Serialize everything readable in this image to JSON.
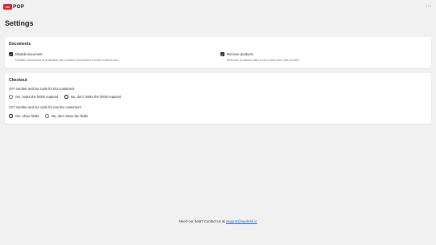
{
  "app": {
    "logo_badge": "ws",
    "logo_text": "POP",
    "more_menu": "···"
  },
  "page": {
    "title": "Settings"
  },
  "documents": {
    "title": "Documents",
    "disable_document": {
      "label": "Disable document",
      "description": "Disable document and disable the number increment if order total is zero.",
      "checked": true
    },
    "remove_products": {
      "label": "Remove products",
      "description": "Remove products with a zero total from the invoice.",
      "checked": true
    }
  },
  "checkout": {
    "title": "Checkout",
    "eu": {
      "label": "VAT number and tax code for EU customers",
      "options": [
        "Yes, make the fields required",
        "No, don't make the fields required"
      ],
      "selected": 1
    },
    "non_eu": {
      "label": "VAT number and tax code for non-EU customers",
      "options": [
        "Yes, show fields",
        "No, don't show the fields"
      ],
      "selected": 0
    }
  },
  "footer": {
    "text": "Need our help? Contact us at",
    "email": "support@wpdesk.io"
  }
}
